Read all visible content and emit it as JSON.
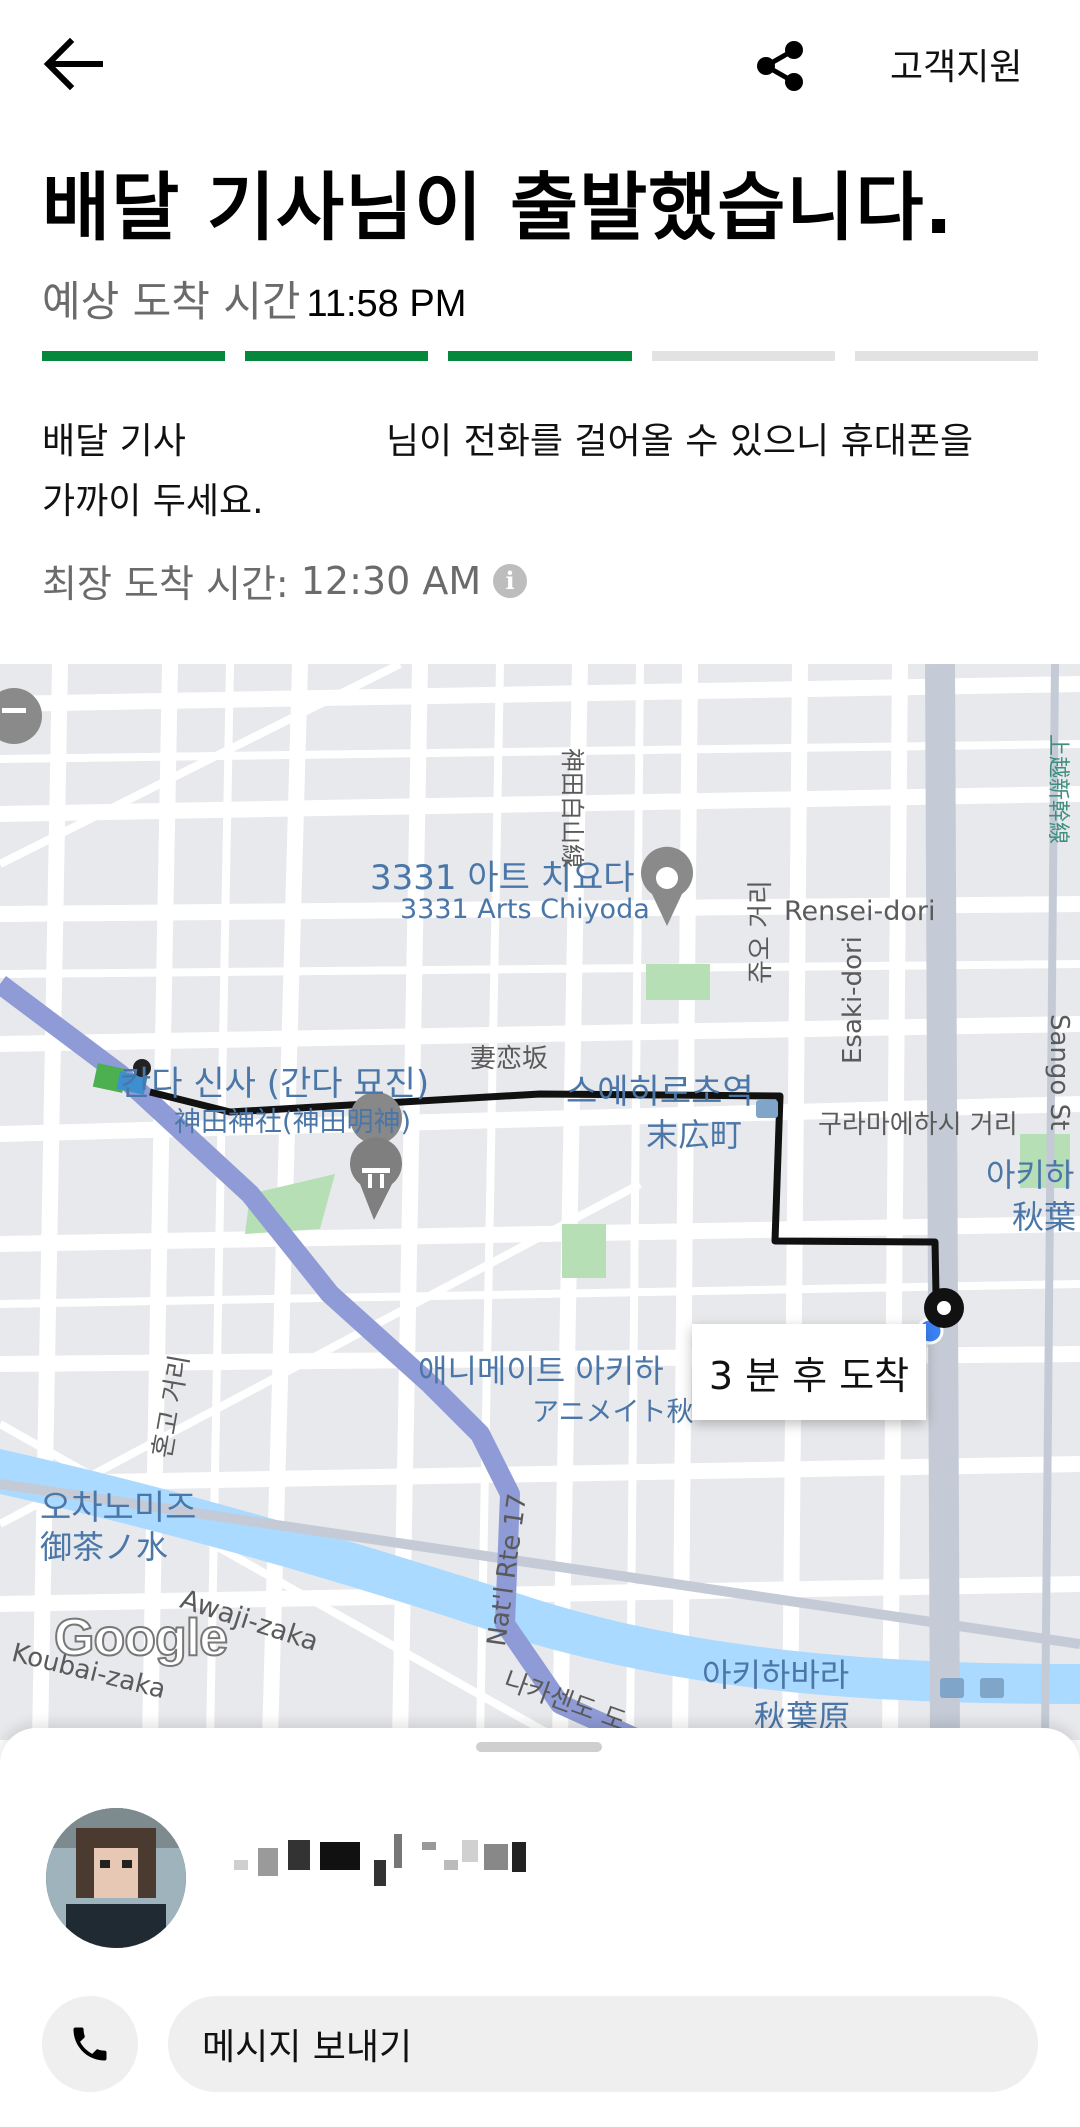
{
  "header": {
    "back_icon": "arrow-left-icon",
    "share_icon": "share-icon",
    "support_label": "고객지원"
  },
  "status": {
    "headline": "배달 기사님이 출발했습니다.",
    "eta_label": "예상 도착 시간",
    "eta_time": "11:58 PM",
    "progress": {
      "total_steps": 5,
      "completed_steps": 3,
      "color_done": "#05873c",
      "color_pending": "#e2e2e2"
    },
    "notice_part1": "배달 기사",
    "notice_part2": "님이 전화를 걸어올 수 있으니 휴대폰을",
    "notice_part3": "가까이 두세요.",
    "latest_label": "최장 도착 시간:",
    "latest_time": "12:30 AM"
  },
  "map": {
    "labels": {
      "arts_ko": "3331 아트 치요다",
      "arts_en": "3331 Arts Chiyoda",
      "shrine_ko": "칸다 신사 (간다 묘진)",
      "shrine_jp": "神田神社(神田明神)",
      "tsumakoizaka": "妻恋坂",
      "station1_ko": "스에히로초역",
      "station1_jp": "末広町",
      "rensei": "Rensei-dori",
      "chuo_st": "쥬오 거리",
      "esaki": "Esaki-dori",
      "kuramae": "구라마에하시 거리",
      "akiba_ko_right": "아키하",
      "akiba_jp_right": "秋葉",
      "sango": "Sango St",
      "animate_ko": "애니메이트 아키하",
      "animate_jp": "アニメイト秋",
      "hongo": "혼고 거리",
      "ochanomizu_ko": "오차노미즈",
      "ochanomizu_jp": "御茶ノ水",
      "awaji": "Awaji-zaka",
      "koubai": "Koubai-zaka",
      "natl_rte": "Nat'l Rte 17",
      "nakasendo": "나카센도 도",
      "akihabara_ko": "아키하바라",
      "akihabara_jp": "秋葉原",
      "kuramae_line": "上越新幹線",
      "hakusan": "神田白山線",
      "google": "Google"
    },
    "eta_bubble": "3 분 후 도착",
    "route_color": "#111111",
    "rail_color": "#8f9bd6"
  },
  "driver": {
    "avatar_icon": "driver-avatar",
    "call_icon": "phone-icon",
    "message_label": "메시지 보내기"
  }
}
